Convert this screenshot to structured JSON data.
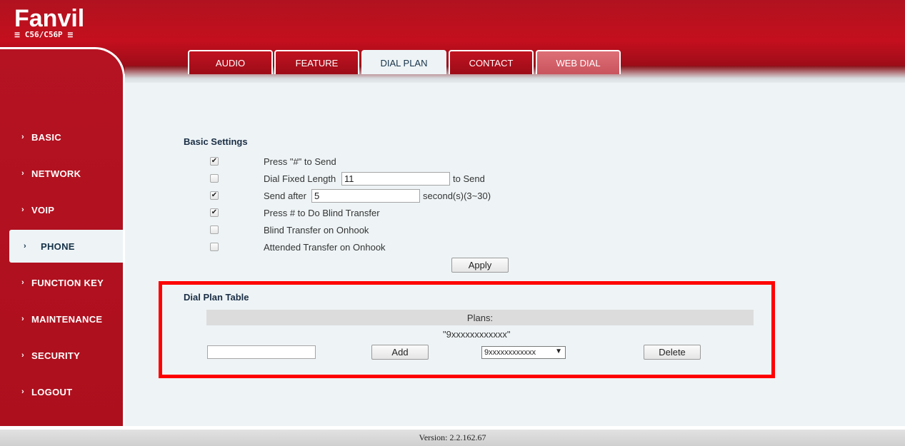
{
  "brand": {
    "logo": "Fanvil",
    "model": "C56/C56P"
  },
  "tabs": [
    {
      "label": "AUDIO",
      "active": false
    },
    {
      "label": "FEATURE",
      "active": false
    },
    {
      "label": "DIAL PLAN",
      "active": true
    },
    {
      "label": "CONTACT",
      "active": false
    },
    {
      "label": "WEB DIAL",
      "active": false
    }
  ],
  "sidebar": {
    "items": [
      {
        "label": "BASIC"
      },
      {
        "label": "NETWORK"
      },
      {
        "label": "VOIP"
      },
      {
        "label": "PHONE",
        "active": true
      },
      {
        "label": "FUNCTION KEY"
      },
      {
        "label": "MAINTENANCE"
      },
      {
        "label": "SECURITY"
      },
      {
        "label": "LOGOUT"
      }
    ]
  },
  "basic_settings": {
    "title": "Basic Settings",
    "press_hash_to_send": {
      "label": "Press \"#\" to Send",
      "checked": true
    },
    "dial_fixed_length": {
      "label": "Dial Fixed Length",
      "value": "11",
      "suffix": "to Send",
      "checked": false
    },
    "send_after": {
      "label": "Send after",
      "value": "5",
      "suffix": "second(s)(3~30)",
      "checked": true
    },
    "blind_transfer_hash": {
      "label": "Press # to Do Blind Transfer",
      "checked": true
    },
    "blind_transfer_onhook": {
      "label": "Blind Transfer on Onhook",
      "checked": false
    },
    "attended_transfer_onhook": {
      "label": "Attended Transfer on Onhook",
      "checked": false
    },
    "apply_label": "Apply"
  },
  "dial_plan_table": {
    "title": "Dial Plan Table",
    "plans_header": "Plans:",
    "plans": [
      "\"9xxxxxxxxxxxx\""
    ],
    "new_plan_value": "",
    "add_label": "Add",
    "selected_plan": "9xxxxxxxxxxxx",
    "delete_label": "Delete"
  },
  "footer": {
    "version": "Version: 2.2.162.67"
  },
  "colors": {
    "brand_red": "#b31221",
    "content_bg": "#eef4f6",
    "highlight": "#ff0000",
    "title_navy": "#1b2e45"
  },
  "icons": {
    "checked": "checkmark-icon",
    "nav_bullet": "chevron-right-icon",
    "select_caret": "caret-down-icon"
  }
}
